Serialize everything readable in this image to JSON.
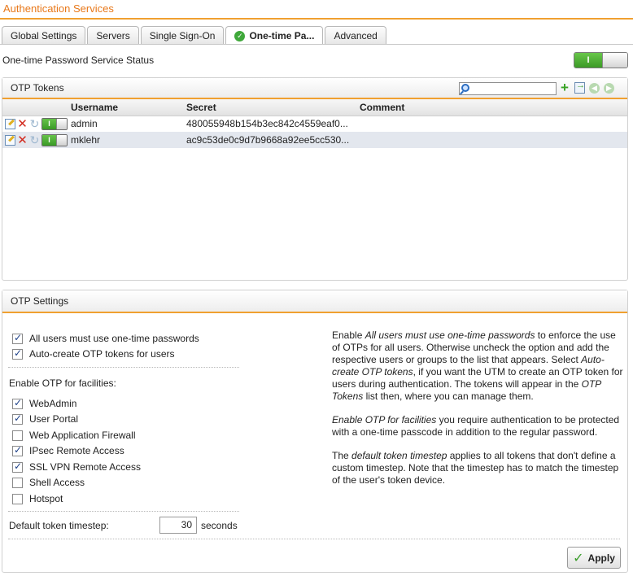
{
  "page_title": "Authentication Services",
  "tabs": [
    {
      "label": "Global Settings",
      "active": false
    },
    {
      "label": "Servers",
      "active": false
    },
    {
      "label": "Single Sign-On",
      "active": false
    },
    {
      "label": "One-time Pa...",
      "active": true
    },
    {
      "label": "Advanced",
      "active": false
    }
  ],
  "status": {
    "label": "One-time Password Service Status",
    "on_text": "I",
    "enabled": true
  },
  "otp_tokens": {
    "title": "OTP Tokens",
    "search_placeholder": "",
    "columns": {
      "username": "Username",
      "secret": "Secret",
      "comment": "Comment"
    },
    "rows": [
      {
        "username": "admin",
        "secret": "480055948b154b3ec842c4559eaf0...",
        "comment": "",
        "enabled": true,
        "toggle_text": "I"
      },
      {
        "username": "mklehr",
        "secret": "ac9c53de0c9d7b9668a92ee5cc530...",
        "comment": "",
        "enabled": true,
        "toggle_text": "I"
      }
    ]
  },
  "otp_settings": {
    "title": "OTP Settings",
    "all_users": {
      "label": "All users must use one-time passwords",
      "checked": true
    },
    "auto_create": {
      "label": "Auto-create OTP tokens for users",
      "checked": true
    },
    "facilities_heading": "Enable OTP for facilities:",
    "facilities": [
      {
        "label": "WebAdmin",
        "checked": true
      },
      {
        "label": "User Portal",
        "checked": true
      },
      {
        "label": "Web Application Firewall",
        "checked": false
      },
      {
        "label": "IPsec Remote Access",
        "checked": true
      },
      {
        "label": "SSL VPN Remote Access",
        "checked": true
      },
      {
        "label": "Shell Access",
        "checked": false
      },
      {
        "label": "Hotspot",
        "checked": false
      }
    ],
    "timestep_label": "Default token timestep:",
    "timestep_value": "30",
    "timestep_unit": "seconds",
    "apply_label": "Apply",
    "help": {
      "p1_a": "Enable ",
      "p1_b": "All users must use one-time passwords",
      "p1_c": " to enforce the use of OTPs for all users. Otherwise uncheck the option and add the respective users or groups to the list that appears. Select ",
      "p1_d": "Auto-create OTP tokens",
      "p1_e": ", if you want the UTM to create an OTP token for users during authentication. The tokens will appear in the ",
      "p1_f": "OTP Tokens",
      "p1_g": " list then, where you can manage them.",
      "p2_a": "Enable OTP for facilities",
      "p2_b": " you require authentication to be protected with a one-time passcode in addition to the regular password.",
      "p3_a": "The ",
      "p3_b": "default token timestep",
      "p3_c": " applies to all tokens that don't define a custom timestep. Note that the timestep has to match the timestep of the user's token device."
    }
  },
  "colors": {
    "accent": "#f0a030",
    "title": "#e8781a",
    "toggle_on": "#3b9a26",
    "row_alt": "#e3e7ee"
  }
}
